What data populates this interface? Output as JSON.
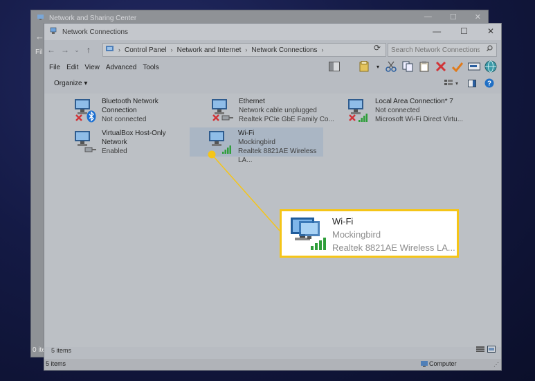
{
  "background_window": {
    "title": "Network and Sharing Center",
    "back_glyph": "←",
    "file_glyph": "Fil",
    "status": "0 ite"
  },
  "window": {
    "title": "Network Connections",
    "controls": {
      "minimize": "—",
      "maximize": "☐",
      "close": "✕"
    }
  },
  "address": {
    "back": "←",
    "forward": "→",
    "recent": "⌄",
    "up": "↑",
    "breadcrumbs": [
      "Control Panel",
      "Network and Internet",
      "Network Connections"
    ],
    "separator": "›",
    "refresh": "⟳",
    "search_placeholder": "Search Network Connections"
  },
  "menu": [
    "File",
    "Edit",
    "View",
    "Advanced",
    "Tools"
  ],
  "toolbar": {
    "organize": "Organize ▾",
    "help": "?"
  },
  "connections": [
    {
      "name": "Bluetooth Network Connection",
      "line1": "Bluetooth Network",
      "line2": "Connection",
      "status": "Not connected",
      "adapter": "",
      "badge": "bluetooth"
    },
    {
      "name": "Ethernet",
      "line1": "Ethernet",
      "line2": "",
      "status": "Network cable unplugged",
      "adapter": "Realtek PCIe GbE Family Co...",
      "badge": "cable"
    },
    {
      "name": "Local Area Connection* 7",
      "line1": "Local Area Connection* 7",
      "line2": "",
      "status": "Not connected",
      "adapter": "Microsoft Wi-Fi Direct Virtu...",
      "badge": "signal"
    },
    {
      "name": "VirtualBox Host-Only Network",
      "line1": "VirtualBox Host-Only",
      "line2": "Network",
      "status": "Enabled",
      "adapter": "",
      "badge": "cable"
    },
    {
      "name": "Wi-Fi",
      "line1": "Wi-Fi",
      "line2": "",
      "status": "Mockingbird",
      "adapter": "Realtek 8821AE Wireless LA...",
      "badge": "signal"
    }
  ],
  "callout": {
    "name": "Wi-Fi",
    "network": "Mockingbird",
    "adapter": "Realtek 8821AE Wireless LA..."
  },
  "status": {
    "items_inner": "5 items",
    "items_bar": "5 items",
    "computer": "Computer"
  },
  "colors": {
    "highlight": "#f5c518",
    "error_x": "#d13438",
    "signal": "#2e9e3a",
    "bluetooth": "#1b6fd1"
  }
}
